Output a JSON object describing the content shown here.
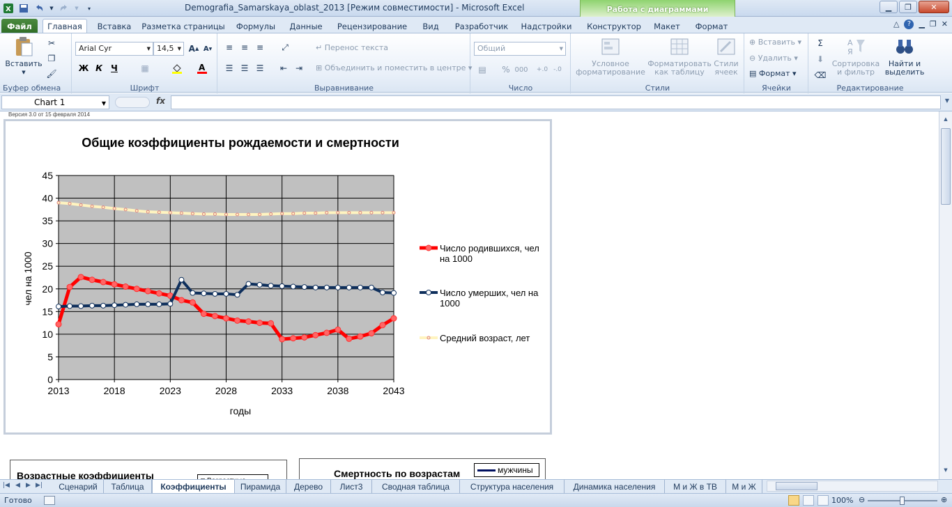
{
  "window": {
    "title": "Demografia_Samarskaya_oblast_2013  [Режим совместимости]  -  Microsoft Excel",
    "context_group": "Работа с диаграммами"
  },
  "tabs": [
    "Файл",
    "Главная",
    "Вставка",
    "Разметка страницы",
    "Формулы",
    "Данные",
    "Рецензирование",
    "Вид",
    "Разработчик",
    "Надстройки",
    "Конструктор",
    "Макет",
    "Формат"
  ],
  "ribbon": {
    "clipboard": {
      "paste": "Вставить",
      "label": "Буфер обмена"
    },
    "font": {
      "name": "Arial Cyr",
      "size": "14,5",
      "bold": "Ж",
      "italic": "К",
      "underline": "Ч",
      "label": "Шрифт"
    },
    "alignment": {
      "wrap": "Перенос текста",
      "merge": "Объединить и поместить в центре",
      "label": "Выравнивание"
    },
    "number": {
      "format": "Общий",
      "label": "Число"
    },
    "styles": {
      "cond1": "Условное",
      "cond2": "форматирование",
      "table1": "Форматировать",
      "table2": "как таблицу",
      "cell1": "Стили",
      "cell2": "ячеек",
      "label": "Стили"
    },
    "cells": {
      "insert": "Вставить",
      "delete": "Удалить",
      "format": "Формат",
      "label": "Ячейки"
    },
    "editing": {
      "sort1": "Сортировка",
      "sort2": "и фильтр",
      "find1": "Найти и",
      "find2": "выделить",
      "label": "Редактирование"
    }
  },
  "formula_bar": {
    "name_box": "Chart 1",
    "fx": "fx",
    "value": ""
  },
  "sheet": {
    "version_note": "Версия 3.0 от 15 февраля 2014"
  },
  "chart_data": {
    "type": "line",
    "title": "Общие коэффициенты рождаемости и смертности",
    "xlabel": "годы",
    "ylabel": "чел на 1000",
    "xlim": [
      2013,
      2043
    ],
    "ylim": [
      0,
      45
    ],
    "x_ticks": [
      "2013",
      "2018",
      "2023",
      "2028",
      "2033",
      "2038",
      "2043"
    ],
    "y_ticks": [
      "0",
      "5",
      "10",
      "15",
      "20",
      "25",
      "30",
      "35",
      "40",
      "45"
    ],
    "grid": true,
    "legend_position": "right",
    "x": [
      2013,
      2014,
      2015,
      2016,
      2017,
      2018,
      2019,
      2020,
      2021,
      2022,
      2023,
      2024,
      2025,
      2026,
      2027,
      2028,
      2029,
      2030,
      2031,
      2032,
      2033,
      2034,
      2035,
      2036,
      2037,
      2038,
      2039,
      2040,
      2041,
      2042,
      2043
    ],
    "series": [
      {
        "name": "Число родившихся, чел на 1000",
        "color": "#ff0000",
        "values": [
          12.2,
          20.4,
          22.6,
          22.0,
          21.5,
          21.0,
          20.5,
          20.0,
          19.5,
          19.0,
          18.5,
          17.5,
          17.0,
          14.5,
          14.0,
          13.5,
          13.0,
          12.8,
          12.5,
          12.4,
          8.9,
          9.1,
          9.3,
          9.8,
          10.3,
          11.0,
          9.0,
          9.5,
          10.2,
          12.0,
          13.5
        ]
      },
      {
        "name": "Число умерших, чел на 1000",
        "color": "#0e2f5c",
        "values": [
          16.1,
          16.2,
          16.2,
          16.3,
          16.3,
          16.4,
          16.5,
          16.6,
          16.6,
          16.6,
          16.7,
          22.0,
          19.1,
          19.0,
          18.9,
          18.9,
          18.7,
          21.1,
          20.9,
          20.7,
          20.6,
          20.5,
          20.4,
          20.3,
          20.3,
          20.3,
          20.3,
          20.3,
          20.3,
          19.2,
          19.1
        ]
      },
      {
        "name": "Средний возраст, лет",
        "color": "#fff4c0",
        "values": [
          39.0,
          38.8,
          38.5,
          38.2,
          38.0,
          37.7,
          37.5,
          37.2,
          37.0,
          36.9,
          36.8,
          36.7,
          36.6,
          36.5,
          36.5,
          36.4,
          36.4,
          36.4,
          36.4,
          36.5,
          36.6,
          36.6,
          36.7,
          36.7,
          36.8,
          36.8,
          36.8,
          36.8,
          36.8,
          36.8,
          36.8
        ]
      }
    ]
  },
  "mini_charts": [
    {
      "title": "Возрастные коэффициенты",
      "legend": "Возрастные"
    },
    {
      "title": "Смертность по возрастам",
      "legend": "мужчины"
    }
  ],
  "sheet_tabs": [
    "Сценарий",
    "Таблица",
    "Коэффициенты",
    "Пирамида",
    "Дерево",
    "Лист3",
    "Сводная таблица",
    "Структура населения",
    "Динамика населения",
    "М и Ж в ТВ",
    "М и Ж"
  ],
  "active_sheet": "Коэффициенты",
  "status": {
    "ready": "Готово",
    "zoom": "100%"
  }
}
